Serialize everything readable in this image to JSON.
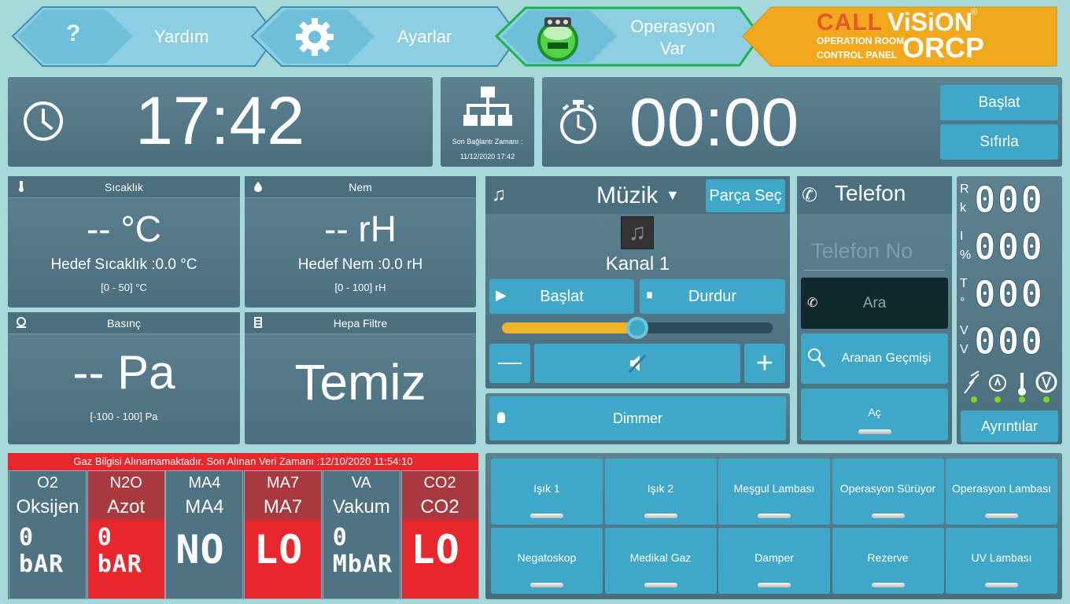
{
  "nav": {
    "help_label": "Yardım",
    "settings_label": "Ayarlar",
    "operation_label_1": "Operasyon",
    "operation_label_2": "Var",
    "brand_call": "CALL",
    "brand_vision": "ViSiON",
    "brand_line1": "OPERATION ROOM",
    "brand_line2": "CONTROL PANEL",
    "brand_orcp": "ORCP",
    "brand_reg": "®"
  },
  "clock": {
    "time": "17:42"
  },
  "network": {
    "label": "Son Bağlantı Zamanı :",
    "value": "11/12/2020 17:42"
  },
  "stopwatch": {
    "time": "00:00",
    "start_label": "Başlat",
    "reset_label": "Sıfırla"
  },
  "temperature": {
    "title": "Sıcaklık",
    "value": "-- °C",
    "target": "Hedef Sıcaklık :0.0 °C",
    "range": "[0 - 50] °C"
  },
  "humidity": {
    "title": "Nem",
    "value": "-- rH",
    "target": "Hedef Nem :0.0 rH",
    "range": "[0 - 100] rH"
  },
  "pressure": {
    "title": "Basınç",
    "value": "-- Pa",
    "range": "[-100 - 100] Pa"
  },
  "hepa": {
    "title": "Hepa Filtre",
    "value": "Temiz"
  },
  "music": {
    "title": "Müzik",
    "select_track": "Parça Seç",
    "channel": "Kanal 1",
    "play_label": "Başlat",
    "stop_label": "Durdur",
    "volume": 0.5,
    "dimmer_label": "Dimmer"
  },
  "phone": {
    "title": "Telefon",
    "placeholder": "Telefon No",
    "call_label": "Ara",
    "history_label": "Aranan Geçmişi",
    "open_label": "Aç"
  },
  "meters": {
    "rows": [
      {
        "l1": "R",
        "l2": "k",
        "value": "000"
      },
      {
        "l1": "I",
        "l2": "%",
        "value": "000"
      },
      {
        "l1": "T",
        "l2": "°",
        "value": "000"
      },
      {
        "l1": "V",
        "l2": "V",
        "value": "000"
      }
    ],
    "details_label": "Ayrıntılar",
    "status_color": "#7ed321"
  },
  "gas": {
    "warning": "Gaz Bilgisi Alınamamaktadır. Son Alınan Veri Zamanı :12/10/2020 11:54:10",
    "items": [
      {
        "code": "O2",
        "name": "Oksijen",
        "v1": "0",
        "v2": "bAR"
      },
      {
        "code": "N2O",
        "name": "Azot",
        "v1": "0",
        "v2": "bAR"
      },
      {
        "code": "MA4",
        "name": "MA4",
        "v1": "NO",
        "v2": ""
      },
      {
        "code": "MA7",
        "name": "MA7",
        "v1": "LO",
        "v2": ""
      },
      {
        "code": "VA",
        "name": "Vakum",
        "v1": "0",
        "v2": "MbAR"
      },
      {
        "code": "CO2",
        "name": "CO2",
        "v1": "LO",
        "v2": ""
      }
    ]
  },
  "lights": [
    {
      "label": "Işık 1"
    },
    {
      "label": "Işık 2"
    },
    {
      "label": "Meşgul Lambası"
    },
    {
      "label": "Operasyon Sürüyor"
    },
    {
      "label": "Operasyon Lambası"
    },
    {
      "label": "Negatoskop"
    },
    {
      "label": "Medikal Gaz"
    },
    {
      "label": "Damper"
    },
    {
      "label": "Rezerve"
    },
    {
      "label": "UV Lambası"
    }
  ],
  "colors": {
    "accent": "#3fa8c8",
    "alarm": "#e8272d",
    "panel": "#4e7383",
    "brand_orange": "#f2a81d"
  }
}
